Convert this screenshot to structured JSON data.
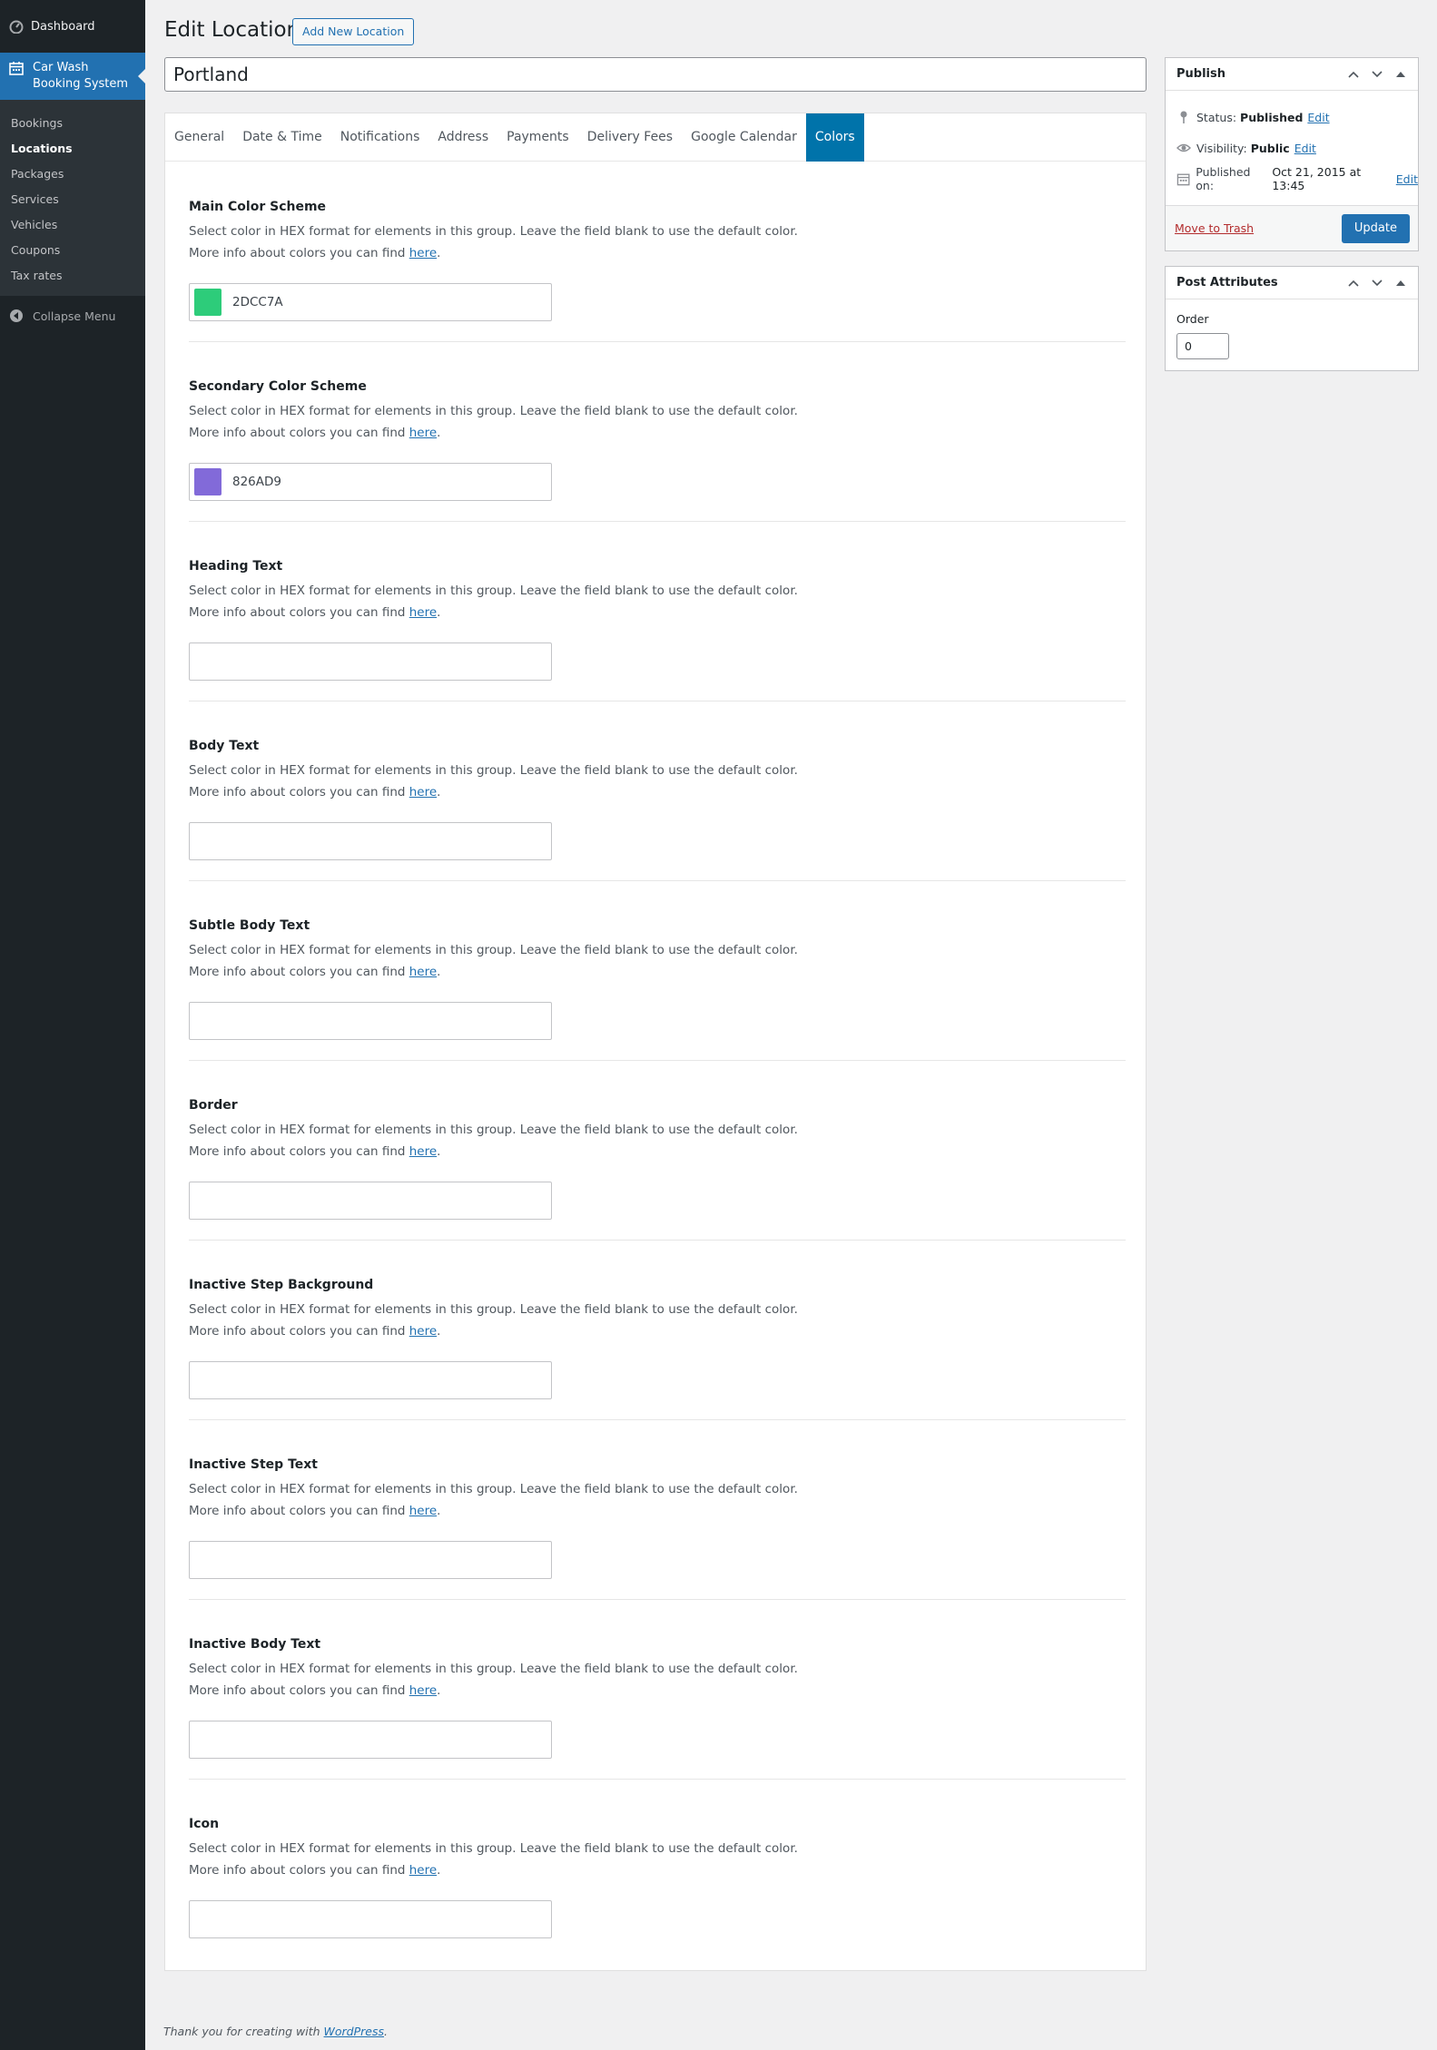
{
  "sidebar": {
    "dashboard": "Dashboard",
    "plugin": "Car Wash Booking System",
    "items": [
      "Bookings",
      "Locations",
      "Packages",
      "Services",
      "Vehicles",
      "Coupons",
      "Tax rates"
    ],
    "current_index": 1,
    "collapse": "Collapse Menu"
  },
  "header": {
    "title": "Edit Location",
    "add_new": "Add New Location"
  },
  "post_title": "Portland",
  "tabs": [
    {
      "label": "General"
    },
    {
      "label": "Date & Time"
    },
    {
      "label": "Notifications"
    },
    {
      "label": "Address"
    },
    {
      "label": "Payments"
    },
    {
      "label": "Delivery Fees"
    },
    {
      "label": "Google Calendar"
    },
    {
      "label": "Colors"
    }
  ],
  "active_tab": 7,
  "sections": [
    {
      "title": "Main Color Scheme",
      "desc": "Select color in HEX format for elements in this group. Leave the field blank to use the default color.",
      "more": "More info about colors you can find",
      "link": "here",
      "value": "2DCC7A",
      "swatch": "#2dcc7a"
    },
    {
      "title": "Secondary Color Scheme",
      "desc": "Select color in HEX format for elements in this group. Leave the field blank to use the default color.",
      "more": "More info about colors you can find",
      "link": "here",
      "value": "826AD9",
      "swatch": "#826ad9"
    },
    {
      "title": "Heading Text",
      "desc": "Select color in HEX format for elements in this group. Leave the field blank to use the default color.",
      "more": "More info about colors you can find",
      "link": "here",
      "value": "",
      "swatch": ""
    },
    {
      "title": "Body Text",
      "desc": "Select color in HEX format for elements in this group. Leave the field blank to use the default color.",
      "more": "More info about colors you can find",
      "link": "here",
      "value": "",
      "swatch": ""
    },
    {
      "title": "Subtle Body Text",
      "desc": "Select color in HEX format for elements in this group. Leave the field blank to use the default color.",
      "more": "More info about colors you can find",
      "link": "here",
      "value": "",
      "swatch": ""
    },
    {
      "title": "Border",
      "desc": "Select color in HEX format for elements in this group. Leave the field blank to use the default color.",
      "more": "More info about colors you can find",
      "link": "here",
      "value": "",
      "swatch": ""
    },
    {
      "title": "Inactive Step Background",
      "desc": "Select color in HEX format for elements in this group. Leave the field blank to use the default color.",
      "more": "More info about colors you can find",
      "link": "here",
      "value": "",
      "swatch": ""
    },
    {
      "title": "Inactive Step Text",
      "desc": "Select color in HEX format for elements in this group. Leave the field blank to use the default color.",
      "more": "More info about colors you can find",
      "link": "here",
      "value": "",
      "swatch": ""
    },
    {
      "title": "Inactive Body Text",
      "desc": "Select color in HEX format for elements in this group. Leave the field blank to use the default color.",
      "more": "More info about colors you can find",
      "link": "here",
      "value": "",
      "swatch": ""
    },
    {
      "title": "Icon",
      "desc": "Select color in HEX format for elements in this group. Leave the field blank to use the default color.",
      "more": "More info about colors you can find",
      "link": "here",
      "value": "",
      "swatch": ""
    }
  ],
  "publish": {
    "title": "Publish",
    "status_label": "Status:",
    "status_value": "Published",
    "visibility_label": "Visibility:",
    "visibility_value": "Public",
    "published_label": "Published on:",
    "published_value": "Oct 21, 2015 at 13:45",
    "edit": "Edit",
    "trash": "Move to Trash",
    "update": "Update"
  },
  "attributes": {
    "title": "Post Attributes",
    "order_label": "Order",
    "order_value": "0"
  },
  "footer": {
    "text": "Thank you for creating with",
    "link": "WordPress",
    "end": "."
  },
  "colors": {
    "sidebar_bg": "#1d2327",
    "accent": "#2271b1",
    "active_tab": "#0073aa"
  }
}
